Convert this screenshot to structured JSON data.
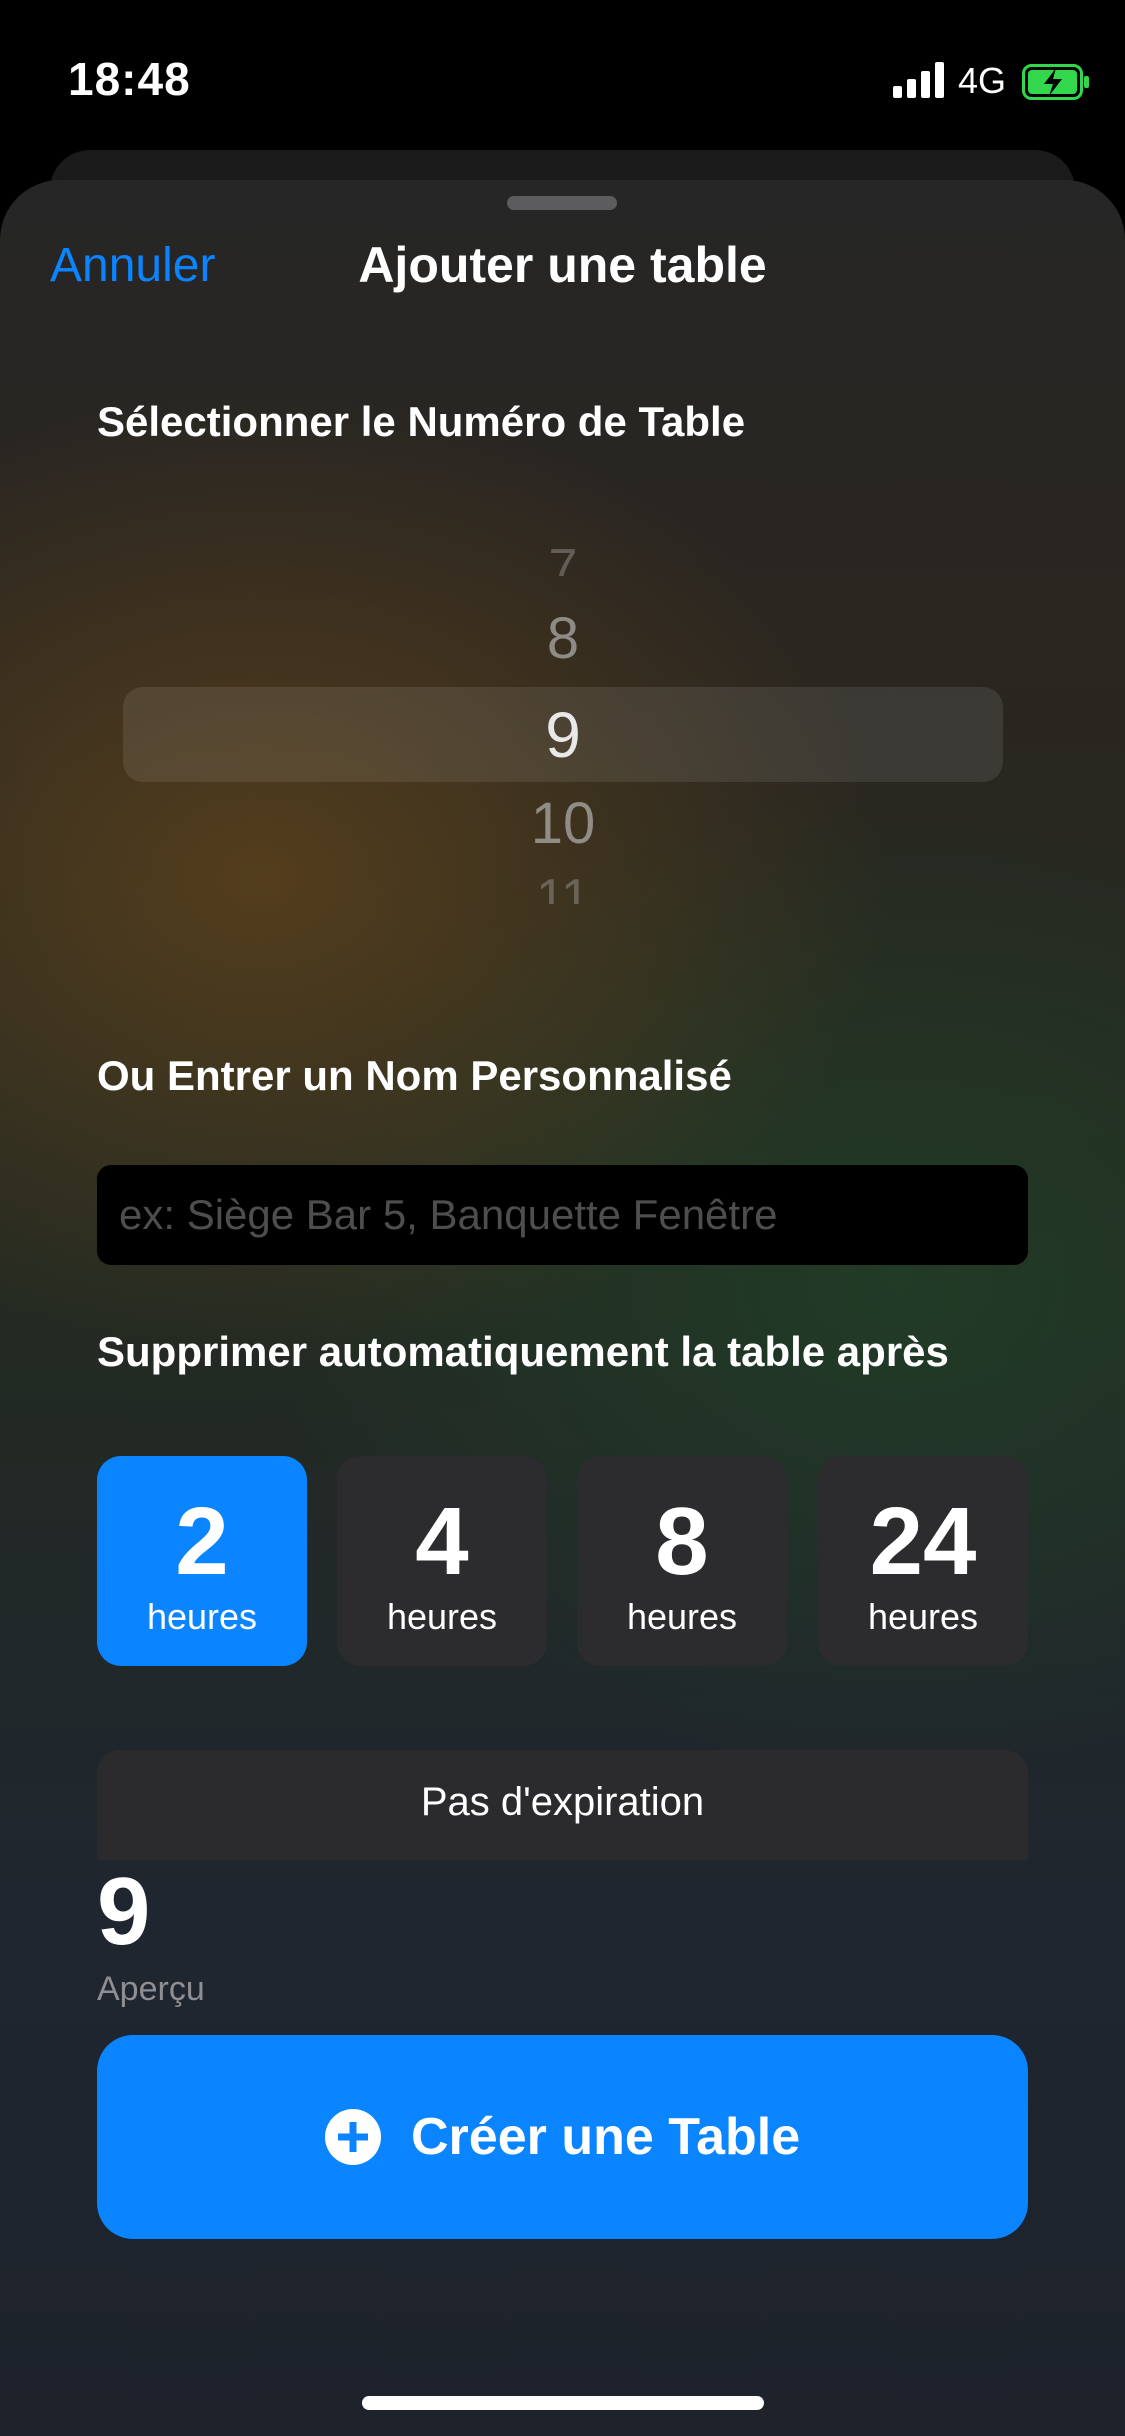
{
  "status_bar": {
    "time": "18:48",
    "network": "4G"
  },
  "nav": {
    "cancel_label": "Annuler",
    "title": "Ajouter une table"
  },
  "table_number": {
    "label": "Sélectionner le Numéro de Table",
    "picker_values": [
      "7",
      "8",
      "9",
      "10",
      "11"
    ],
    "selected": "9"
  },
  "custom_name": {
    "label": "Ou Entrer un Nom Personnalisé",
    "placeholder": "ex: Siège Bar 5, Banquette Fenêtre",
    "value": ""
  },
  "auto_delete": {
    "label": "Supprimer automatiquement la table après",
    "options": [
      {
        "value": "2",
        "unit": "heures"
      },
      {
        "value": "4",
        "unit": "heures"
      },
      {
        "value": "8",
        "unit": "heures"
      },
      {
        "value": "24",
        "unit": "heures"
      }
    ],
    "selected_index": 0,
    "no_expiration_label": "Pas d'expiration"
  },
  "preview": {
    "value": "9",
    "label": "Aperçu"
  },
  "create_button": {
    "label": "Créer une Table"
  },
  "colors": {
    "accent": "#0a84ff",
    "tile": "#2c2c2e",
    "battery": "#32d74b"
  }
}
